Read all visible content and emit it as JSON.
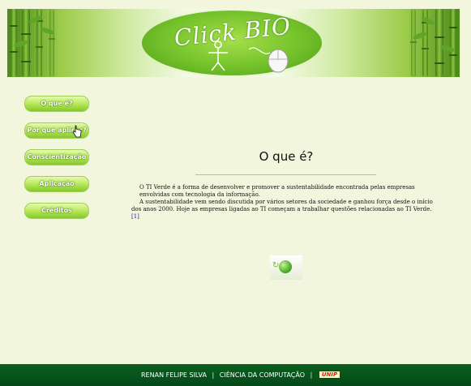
{
  "banner": {
    "title": "Click BIO",
    "icons": [
      "bamboo-stalks",
      "stick-figure-icon",
      "mouse-icon"
    ]
  },
  "nav": {
    "items": [
      {
        "label": "O que é?"
      },
      {
        "label": "Por que aplicar?"
      },
      {
        "label": "Conscientização"
      },
      {
        "label": "Aplicação"
      },
      {
        "label": "Créditos"
      }
    ]
  },
  "main": {
    "title": "O que é?",
    "paragraph1": "O TI Verde é a forma de desenvolver e promover a sustentabilidade encontrada pelas empresas envolvidas com tecnologia da informação.",
    "paragraph2": "A sustentabilidade vem sendo discutida por vários setores da sociedade e ganhou força desde o início dos anos 2000. Hoje as empresas ligadas ao TI começam a trabalhar questões relacionadas ao TI Verde.",
    "reference": "[1]",
    "image_icon": "green-globe-icon"
  },
  "footer": {
    "author": "RENAN FELIPE SILVA",
    "separator": "|",
    "course": "CIÊNCIA DA COMPUTAÇÃO",
    "logo_text": "UNIP"
  },
  "colors": {
    "background": "#f2f6dd",
    "accent_green": "#86c72c",
    "footer_green": "#0a5f1e"
  }
}
